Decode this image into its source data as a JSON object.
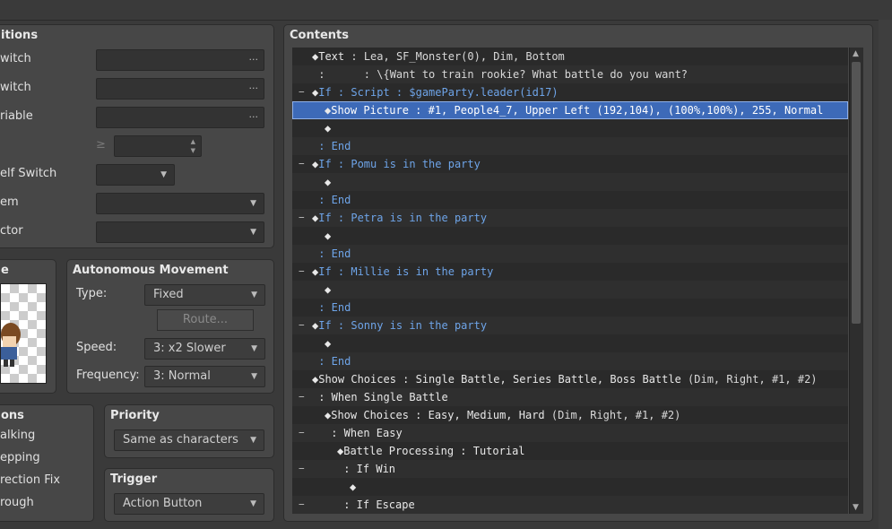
{
  "conditions": {
    "title": "itions",
    "rows": [
      {
        "label": "witch",
        "kind": "browse"
      },
      {
        "label": "witch",
        "kind": "browse"
      },
      {
        "label": "riable",
        "kind": "browse"
      },
      {
        "label": "",
        "kind": "number",
        "sign": "≥"
      },
      {
        "label": "elf Switch",
        "kind": "select"
      },
      {
        "label": "em",
        "kind": "select"
      },
      {
        "label": "ctor",
        "kind": "select"
      }
    ]
  },
  "image": {
    "title": "e"
  },
  "autonomous_movement": {
    "title": "Autonomous Movement",
    "type_label": "Type:",
    "type_value": "Fixed",
    "route_label": "Route...",
    "speed_label": "Speed:",
    "speed_value": "3: x2 Slower",
    "frequency_label": "Frequency:",
    "frequency_value": "3: Normal"
  },
  "options": {
    "title": "ons",
    "items": [
      "alking",
      "epping",
      "rection Fix",
      "rough"
    ]
  },
  "priority": {
    "title": "Priority",
    "value": "Same as characters"
  },
  "trigger": {
    "title": "Trigger",
    "value": "Action Button"
  },
  "contents": {
    "title": "Contents",
    "rows": [
      {
        "indent": 0,
        "tree": "",
        "diamond": true,
        "parts": [
          {
            "t": "Text",
            "c": "cmd"
          },
          {
            "t": " : Lea, SF_Monster(0), Dim, Bottom",
            "c": ""
          }
        ]
      },
      {
        "indent": 0,
        "tree": "",
        "diamond": false,
        "parts": [
          {
            "t": " :      : \\{Want to train rookie? What battle do you want?",
            "c": ""
          }
        ]
      },
      {
        "indent": 0,
        "tree": "−",
        "diamond": true,
        "parts": [
          {
            "t": "If : Script : $gameParty.leader(id17)",
            "c": "cond"
          }
        ]
      },
      {
        "indent": 1,
        "tree": "",
        "diamond": true,
        "selected": true,
        "parts": [
          {
            "t": "Show Picture : #1, People4_7, Upper Left (192,104), (100%,100%), 255, Normal",
            "c": ""
          }
        ]
      },
      {
        "indent": 1,
        "tree": "",
        "diamond": true,
        "parts": []
      },
      {
        "indent": 0,
        "tree": "",
        "diamond": false,
        "parts": [
          {
            "t": " : End",
            "c": "cond"
          }
        ]
      },
      {
        "indent": 0,
        "tree": "−",
        "diamond": true,
        "parts": [
          {
            "t": "If : Pomu is in the party",
            "c": "cond"
          }
        ]
      },
      {
        "indent": 1,
        "tree": "",
        "diamond": true,
        "parts": []
      },
      {
        "indent": 0,
        "tree": "",
        "diamond": false,
        "parts": [
          {
            "t": " : End",
            "c": "cond"
          }
        ]
      },
      {
        "indent": 0,
        "tree": "−",
        "diamond": true,
        "parts": [
          {
            "t": "If : Petra is in the party",
            "c": "cond"
          }
        ]
      },
      {
        "indent": 1,
        "tree": "",
        "diamond": true,
        "parts": []
      },
      {
        "indent": 0,
        "tree": "",
        "diamond": false,
        "parts": [
          {
            "t": " : End",
            "c": "cond"
          }
        ]
      },
      {
        "indent": 0,
        "tree": "−",
        "diamond": true,
        "parts": [
          {
            "t": "If : Millie is in the party",
            "c": "cond"
          }
        ]
      },
      {
        "indent": 1,
        "tree": "",
        "diamond": true,
        "parts": []
      },
      {
        "indent": 0,
        "tree": "",
        "diamond": false,
        "parts": [
          {
            "t": " : End",
            "c": "cond"
          }
        ]
      },
      {
        "indent": 0,
        "tree": "−",
        "diamond": true,
        "parts": [
          {
            "t": "If : Sonny is in the party",
            "c": "cond"
          }
        ]
      },
      {
        "indent": 1,
        "tree": "",
        "diamond": true,
        "parts": []
      },
      {
        "indent": 0,
        "tree": "",
        "diamond": false,
        "parts": [
          {
            "t": " : End",
            "c": "cond"
          }
        ]
      },
      {
        "indent": 0,
        "tree": "",
        "diamond": true,
        "parts": [
          {
            "t": "Show Choices : Single Battle, Series Battle, Boss Battle",
            "c": "cmd"
          },
          {
            "t": " (Dim, Right, #1, #2)",
            "c": ""
          }
        ]
      },
      {
        "indent": 0,
        "tree": "−",
        "diamond": false,
        "parts": [
          {
            "t": " : When Single Battle",
            "c": "cmd"
          }
        ]
      },
      {
        "indent": 1,
        "tree": "",
        "diamond": true,
        "parts": [
          {
            "t": "Show Choices : Easy, Medium, Hard",
            "c": "cmd"
          },
          {
            "t": " (Dim, Right, #1, #2)",
            "c": ""
          }
        ]
      },
      {
        "indent": 1,
        "tree": "−",
        "diamond": false,
        "parts": [
          {
            "t": " : When Easy",
            "c": "cmd"
          }
        ]
      },
      {
        "indent": 2,
        "tree": "",
        "diamond": true,
        "parts": [
          {
            "t": "Battle Processing : Tutorial",
            "c": "cmd"
          }
        ]
      },
      {
        "indent": 2,
        "tree": "−",
        "diamond": false,
        "parts": [
          {
            "t": " : If Win",
            "c": "cmd"
          }
        ]
      },
      {
        "indent": 3,
        "tree": "",
        "diamond": true,
        "parts": []
      },
      {
        "indent": 2,
        "tree": "−",
        "diamond": false,
        "parts": [
          {
            "t": " : If Escape",
            "c": "cmd"
          }
        ]
      }
    ]
  }
}
